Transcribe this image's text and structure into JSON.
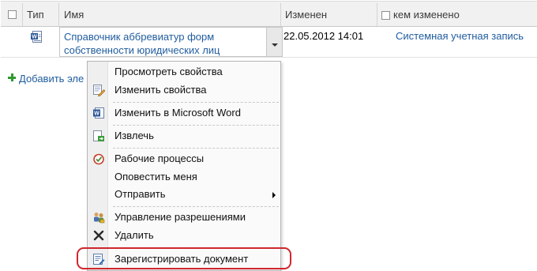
{
  "header": {
    "type_label": "Тип",
    "name_label": "Имя",
    "modified_label": "Изменен",
    "modified_by_label": "кем изменено"
  },
  "item": {
    "name": "Справочник аббревиатур форм собственности юридических лиц",
    "modified": "22.05.2012 14:01",
    "modified_by": "Системная учетная запись"
  },
  "add_link": "Добавить эле",
  "menu": {
    "view_properties": "Просмотреть свойства",
    "edit_properties": "Изменить свойства",
    "edit_in_word": "Изменить в Microsoft Word",
    "check_out": "Извлечь",
    "workflows": "Рабочие процессы",
    "alert_me": "Оповестить меня",
    "send_to": "Отправить",
    "manage_permissions": "Управление разрешениями",
    "delete": "Удалить",
    "register_document": "Зарегистрировать документ"
  },
  "colors": {
    "link": "#1f5c9e",
    "highlight": "#d0262d"
  }
}
